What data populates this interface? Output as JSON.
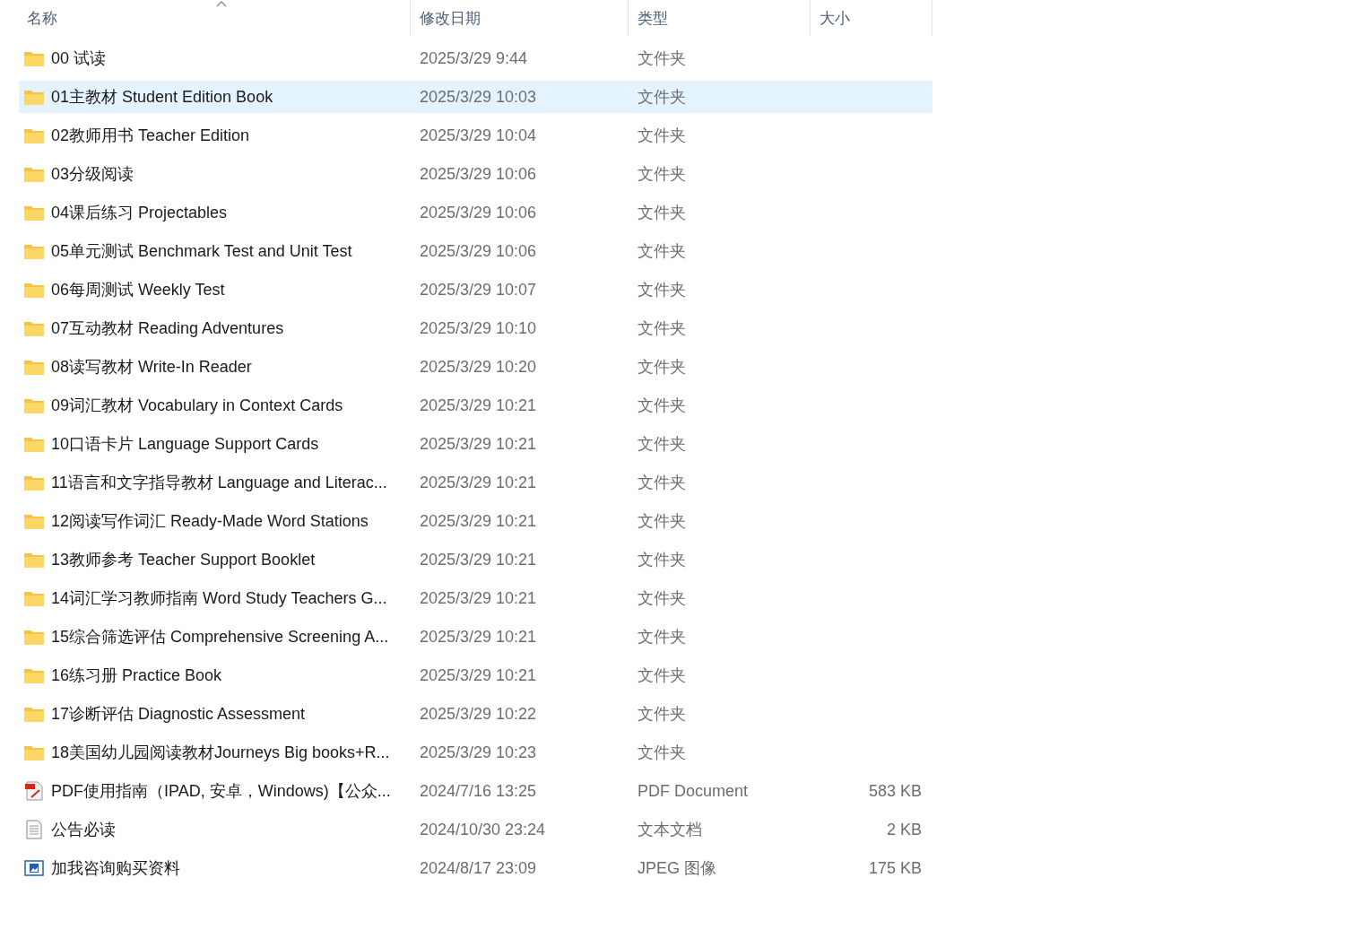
{
  "columns": [
    {
      "label": "名称",
      "sorted": true
    },
    {
      "label": "修改日期",
      "sorted": false
    },
    {
      "label": "类型",
      "sorted": false
    },
    {
      "label": "大小",
      "sorted": false
    }
  ],
  "files": [
    {
      "kind": "folder",
      "name": "00 试读",
      "modified": "2025/3/29 9:44",
      "type": "文件夹",
      "selected": false
    },
    {
      "kind": "folder",
      "name": "01主教材 Student Edition Book",
      "modified": "2025/3/29 10:03",
      "type": "文件夹",
      "selected": true
    },
    {
      "kind": "folder",
      "name": "02教师用书 Teacher Edition",
      "modified": "2025/3/29 10:04",
      "type": "文件夹",
      "selected": false
    },
    {
      "kind": "folder",
      "name": "03分级阅读",
      "modified": "2025/3/29 10:06",
      "type": "文件夹",
      "selected": false
    },
    {
      "kind": "folder",
      "name": "04课后练习 Projectables",
      "modified": "2025/3/29 10:06",
      "type": "文件夹",
      "selected": false
    },
    {
      "kind": "folder",
      "name": "05单元测试 Benchmark Test and Unit Test",
      "modified": "2025/3/29 10:06",
      "type": "文件夹",
      "selected": false
    },
    {
      "kind": "folder",
      "name": "06每周测试 Weekly Test",
      "modified": "2025/3/29 10:07",
      "type": "文件夹",
      "selected": false
    },
    {
      "kind": "folder",
      "name": "07互动教材 Reading Adventures",
      "modified": "2025/3/29 10:10",
      "type": "文件夹",
      "selected": false
    },
    {
      "kind": "folder",
      "name": "08读写教材 Write-In Reader",
      "modified": "2025/3/29 10:20",
      "type": "文件夹",
      "selected": false
    },
    {
      "kind": "folder",
      "name": "09词汇教材 Vocabulary in Context Cards",
      "modified": "2025/3/29 10:21",
      "type": "文件夹",
      "selected": false
    },
    {
      "kind": "folder",
      "name": "10口语卡片 Language Support Cards",
      "modified": "2025/3/29 10:21",
      "type": "文件夹",
      "selected": false
    },
    {
      "kind": "folder",
      "name": "11语言和文字指导教材 Language and Literac...",
      "modified": "2025/3/29 10:21",
      "type": "文件夹",
      "selected": false
    },
    {
      "kind": "folder",
      "name": "12阅读写作词汇 Ready-Made Word Stations",
      "modified": "2025/3/29 10:21",
      "type": "文件夹",
      "selected": false
    },
    {
      "kind": "folder",
      "name": "13教师参考 Teacher Support Booklet",
      "modified": "2025/3/29 10:21",
      "type": "文件夹",
      "selected": false
    },
    {
      "kind": "folder",
      "name": "14词汇学习教师指南 Word Study Teachers G...",
      "modified": "2025/3/29 10:21",
      "type": "文件夹",
      "selected": false
    },
    {
      "kind": "folder",
      "name": "15综合筛选评估 Comprehensive Screening A...",
      "modified": "2025/3/29 10:21",
      "type": "文件夹",
      "selected": false
    },
    {
      "kind": "folder",
      "name": "16练习册 Practice Book",
      "modified": "2025/3/29 10:21",
      "type": "文件夹",
      "selected": false
    },
    {
      "kind": "folder",
      "name": "17诊断评估 Diagnostic Assessment",
      "modified": "2025/3/29 10:22",
      "type": "文件夹",
      "selected": false
    },
    {
      "kind": "folder",
      "name": "18美国幼儿园阅读教材Journeys Big books+R...",
      "modified": "2025/3/29 10:23",
      "type": "文件夹",
      "selected": false
    },
    {
      "kind": "pdf",
      "name": "PDF使用指南（IPAD, 安卓，Windows)【公众...",
      "modified": "2024/7/16 13:25",
      "type": "PDF Document",
      "size": "583 KB",
      "selected": false
    },
    {
      "kind": "text",
      "name": "公告必读",
      "modified": "2024/10/30 23:24",
      "type": "文本文档",
      "size": "2 KB",
      "selected": false
    },
    {
      "kind": "image",
      "name": "加我咨询购买资料",
      "modified": "2024/8/17 23:09",
      "type": "JPEG 图像",
      "size": "175 KB",
      "selected": false
    }
  ]
}
